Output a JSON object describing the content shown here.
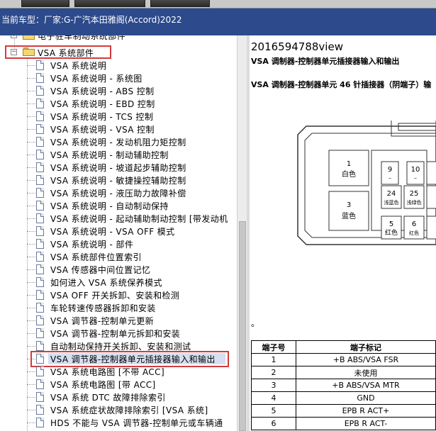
{
  "vehicle": {
    "label": "当前车型：",
    "value": "厂家:G-广汽本田雅阁(Accord)2022"
  },
  "tree": {
    "partial_parent_label": "电子驻车制动系统部件",
    "folder_label": "VSA 系统部件",
    "items": [
      "VSA 系统说明",
      "VSA 系统说明 - 系统图",
      "VSA 系统说明 - ABS 控制",
      "VSA 系统说明 - EBD 控制",
      "VSA 系统说明 - TCS 控制",
      "VSA 系统说明 - VSA 控制",
      "VSA 系统说明 - 发动机阻力矩控制",
      "VSA 系统说明 - 制动辅助控制",
      "VSA 系统说明 - 坡道起步辅助控制",
      "VSA 系统说明 - 敏捷操控辅助控制",
      "VSA 系统说明 - 液压助力故障补偿",
      "VSA 系统说明 - 自动制动保持",
      "VSA 系统说明 - 起动辅助制动控制 [带发动机",
      "VSA 系统说明 - VSA OFF 模式",
      "VSA 系统说明 - 部件",
      "VSA 系统部件位置索引",
      "VSA 传感器中间位置记忆",
      "如何进入 VSA 系统保养模式",
      "VSA OFF 开关拆卸、安装和检测",
      "车轮转速传感器拆卸和安装",
      "VSA 调节器-控制单元更新",
      "VSA 调节器-控制单元拆卸和安装",
      "自动制动保持开关拆卸、安装和测试",
      "VSA 调节器-控制器单元插接器输入和输出",
      "VSA 系统电路图 [不带 ACC]",
      "VSA 系统电路图 [带 ACC]",
      "VSA 系统 DTC 故障排除索引",
      "VSA 系统症状故障排除索引 [VSA 系统]",
      "HDS 不能与 VSA 调节器-控制单元或车辆通"
    ],
    "selected_index": 23
  },
  "content": {
    "doc_id": "2016594788view",
    "title": "VSA 调制器-控制器单元插接器输入和输出",
    "connector_title": "VSA 调制器-控制器单元 46 针插接器（阴端子）输",
    "dot": "。",
    "connector_pins": [
      {
        "num": "1",
        "color": "白色"
      },
      {
        "num": "3",
        "color": "蓝色"
      },
      {
        "num": "9",
        "color": "–"
      },
      {
        "num": "10",
        "color": "–"
      },
      {
        "num": "24",
        "color": "浅蓝色"
      },
      {
        "num": "25",
        "color": "浅绿色"
      },
      {
        "num": "5",
        "color": "红色"
      },
      {
        "num": "6",
        "color": "红色"
      }
    ],
    "table": {
      "headers": [
        "端子号",
        "端子标记"
      ],
      "rows": [
        [
          "1",
          "+B ABS/VSA FSR"
        ],
        [
          "2",
          "未使用"
        ],
        [
          "3",
          "+B ABS/VSA MTR"
        ],
        [
          "4",
          "GND"
        ],
        [
          "5",
          "EPB R ACT+"
        ],
        [
          "6",
          "EPB R ACT-"
        ]
      ]
    }
  }
}
